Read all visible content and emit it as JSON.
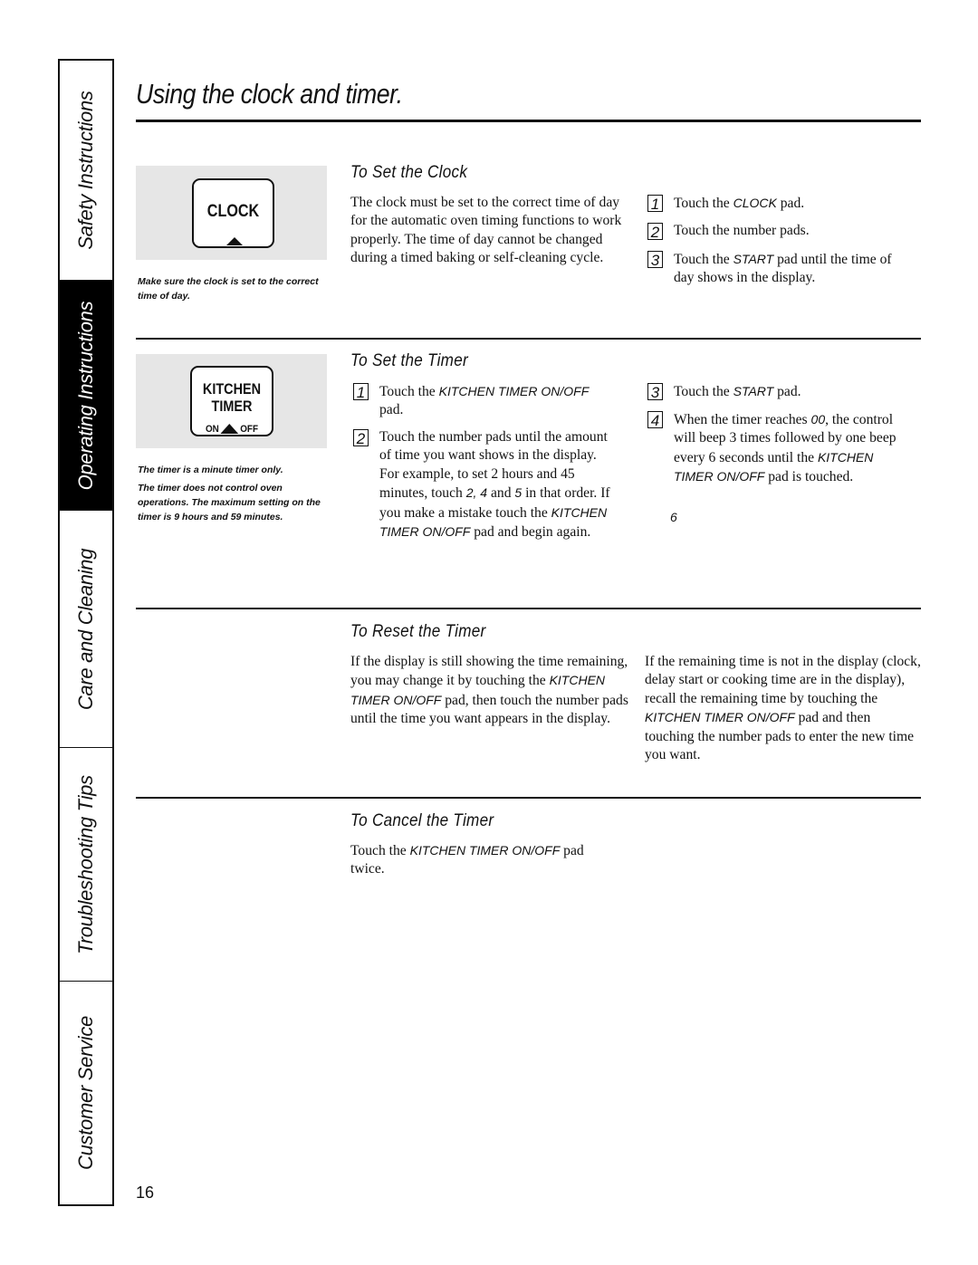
{
  "sidebar": {
    "tabs": [
      {
        "label": "Safety Instructions",
        "active": false
      },
      {
        "label": "Operating Instructions",
        "active": true
      },
      {
        "label": "Care and Cleaning",
        "active": false
      },
      {
        "label": "Troubleshooting Tips",
        "active": false
      },
      {
        "label": "Customer Service",
        "active": false
      }
    ]
  },
  "page": {
    "title": "Using the clock and timer.",
    "number": "16"
  },
  "clock_section": {
    "pad_label": "CLOCK",
    "caption": "Make sure the clock is set to the correct time of day.",
    "heading": "To Set the Clock",
    "intro": "The clock must be set to the correct time of day for the automatic oven timing functions to work properly. The time of day cannot be changed during a timed baking or self-cleaning cycle.",
    "steps": [
      {
        "num": "1",
        "pre": "Touch the ",
        "em": "CLOCK",
        "post": " pad."
      },
      {
        "num": "2",
        "pre": "Touch the number pads.",
        "em": "",
        "post": ""
      },
      {
        "num": "3",
        "pre": "Touch the ",
        "em": "START",
        "post": " pad until the time of day shows in the display."
      }
    ]
  },
  "timer_section": {
    "pad_label_line1": "KITCHEN",
    "pad_label_line2": "TIMER",
    "pad_on": "ON",
    "pad_off": "OFF",
    "caption1": "The timer is a minute timer only.",
    "caption2": "The timer does not control oven operations. The maximum setting on the timer is 9 hours and 59 minutes.",
    "heading": "To Set the Timer",
    "steps": [
      {
        "num": "1",
        "parts": [
          "Touch the ",
          {
            "em": "KITCHEN TIMER ON/OFF"
          },
          " pad."
        ]
      },
      {
        "num": "2",
        "parts": [
          "Touch the number pads until the amount of time you want shows in the display. For example, to set 2 hours and 45 minutes, touch ",
          {
            "em": "2, 4"
          },
          " and ",
          {
            "em": "5"
          },
          " in that order. If you make a mistake touch the ",
          {
            "em": "KITCHEN TIMER ON/OFF"
          },
          " pad and begin again."
        ]
      },
      {
        "num": "3",
        "parts": [
          "Touch the ",
          {
            "em": "START"
          },
          " pad."
        ]
      },
      {
        "num": "4",
        "parts": [
          "When the timer reaches ",
          {
            "em": "00"
          },
          ", the control will beep 3 times followed by one beep every 6 seconds until the ",
          {
            "em": "KITCHEN TIMER ON/OFF"
          },
          " pad is touched."
        ]
      }
    ],
    "stray_mark": "6"
  },
  "reset_section": {
    "heading": "To Reset the Timer",
    "col1": [
      "If the display is still showing the time remaining, you may change it by touching the ",
      {
        "em": "KITCHEN TIMER ON/OFF"
      },
      " pad, then touch the number pads until the time you want appears in the display."
    ],
    "col2": [
      "If the remaining time is not in the display (clock, delay start or cooking time are in the display), recall the remaining time by touching the ",
      {
        "em": "KITCHEN TIMER ON/OFF"
      },
      " pad and then touching the number pads to enter the new time you want."
    ]
  },
  "cancel_section": {
    "heading": "To Cancel the Timer",
    "body": [
      "Touch the ",
      {
        "em": "KITCHEN TIMER ON/OFF"
      },
      " pad twice."
    ]
  }
}
